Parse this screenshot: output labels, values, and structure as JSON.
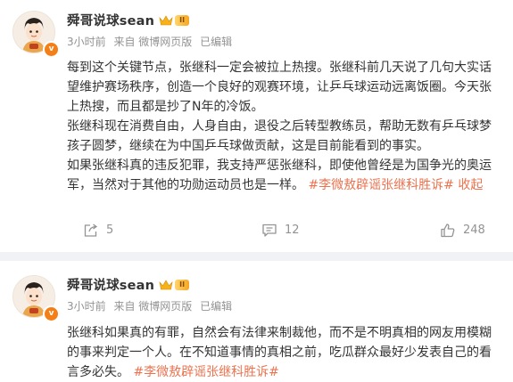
{
  "posts": [
    {
      "username": "舜哥说球sean",
      "level_badge": "II",
      "verified_badge": "v",
      "time": "3小时前",
      "source": "来自 微博网页版",
      "edited": "已编辑",
      "paragraphs": [
        [
          "每到这个关键节点，张继科一定会被拉上热搜。张继科前几天说了几句大实话"
        ],
        [
          "望维护赛场秩序，创造一个良好的观赛环境，让乒乓球运动远离饭圈。今天张"
        ],
        [
          "上热搜，而且都是抄了N年的冷饭。"
        ],
        [
          "张继科现在消费自由，人身自由，退役之后转型教练员，帮助无数有乒乓球梦"
        ],
        [
          "孩子圆梦，继续在为中国乒乓球做贡献，这是目前能看到的事实。"
        ],
        [
          "如果张继科真的违反犯罪，我支持严惩张继科，即使他曾经是为国争光的奥运"
        ],
        [
          "军，当然对于其他的功勋运动员也是一样。"
        ]
      ],
      "hashtag": "#李微敖辟谣张继科胜诉#",
      "collapse_label": "收起",
      "actions": {
        "repost": "5",
        "comment": "12",
        "like": "248"
      }
    },
    {
      "username": "舜哥说球sean",
      "level_badge": "II",
      "verified_badge": "v",
      "time": "3小时前",
      "source": "来自 微博网页版",
      "edited": "已编辑",
      "paragraphs": [
        [
          "张继科如果真的有罪，自然会有法律来制裁他，而不是不明真相的网友用模糊"
        ],
        [
          "的事来判定一个人。在不知道事情的真相之前，吃瓜群众最好少发表自己的看"
        ],
        [
          "言多必失。"
        ]
      ],
      "hashtag": "#李微敖辟谣张继科胜诉#"
    }
  ],
  "colors": {
    "text": "#333333",
    "meta": "#939393",
    "hashtag": "#eb7350",
    "verified": "#f57f17",
    "divider": "#f1f2f5"
  },
  "icons": {
    "repost": "share-arrow-icon",
    "comment": "comment-bubble-icon",
    "like": "thumbs-up-icon",
    "crown": "crown-icon"
  }
}
